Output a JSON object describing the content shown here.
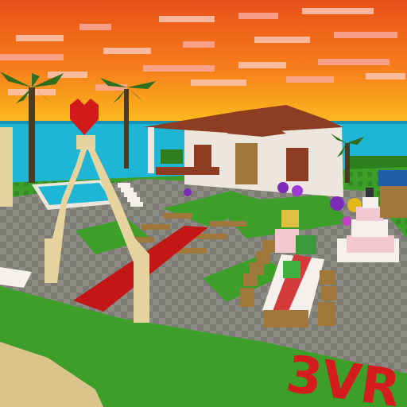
{
  "scene": {
    "description_free": true,
    "palette": {
      "sky_top": "#e8501a",
      "sky_mid": "#f77f1b",
      "sky_low": "#fbc01e",
      "sea": "#1fb6d6",
      "sea_dark": "#1592b5",
      "grass": "#3d9e2a",
      "grass_dark": "#2f7f1f",
      "stone": "#8c8c84",
      "stone_dark": "#6e6e68",
      "sand": "#d9c48a",
      "roof": "#8e3d22",
      "wall": "#ece6dc",
      "wood": "#a0783c",
      "carpet": "#c31717",
      "arch": "#e6d39e",
      "heart": "#d21a1a",
      "cake_pink": "#f3c8d2",
      "cake_white": "#f4f0ec",
      "table_red": "#d63b3b",
      "letters": "#d41c1c",
      "palm_leaf": "#2f6e1c",
      "palm_trunk": "#4a3a22"
    },
    "banner_text": "3VR"
  }
}
